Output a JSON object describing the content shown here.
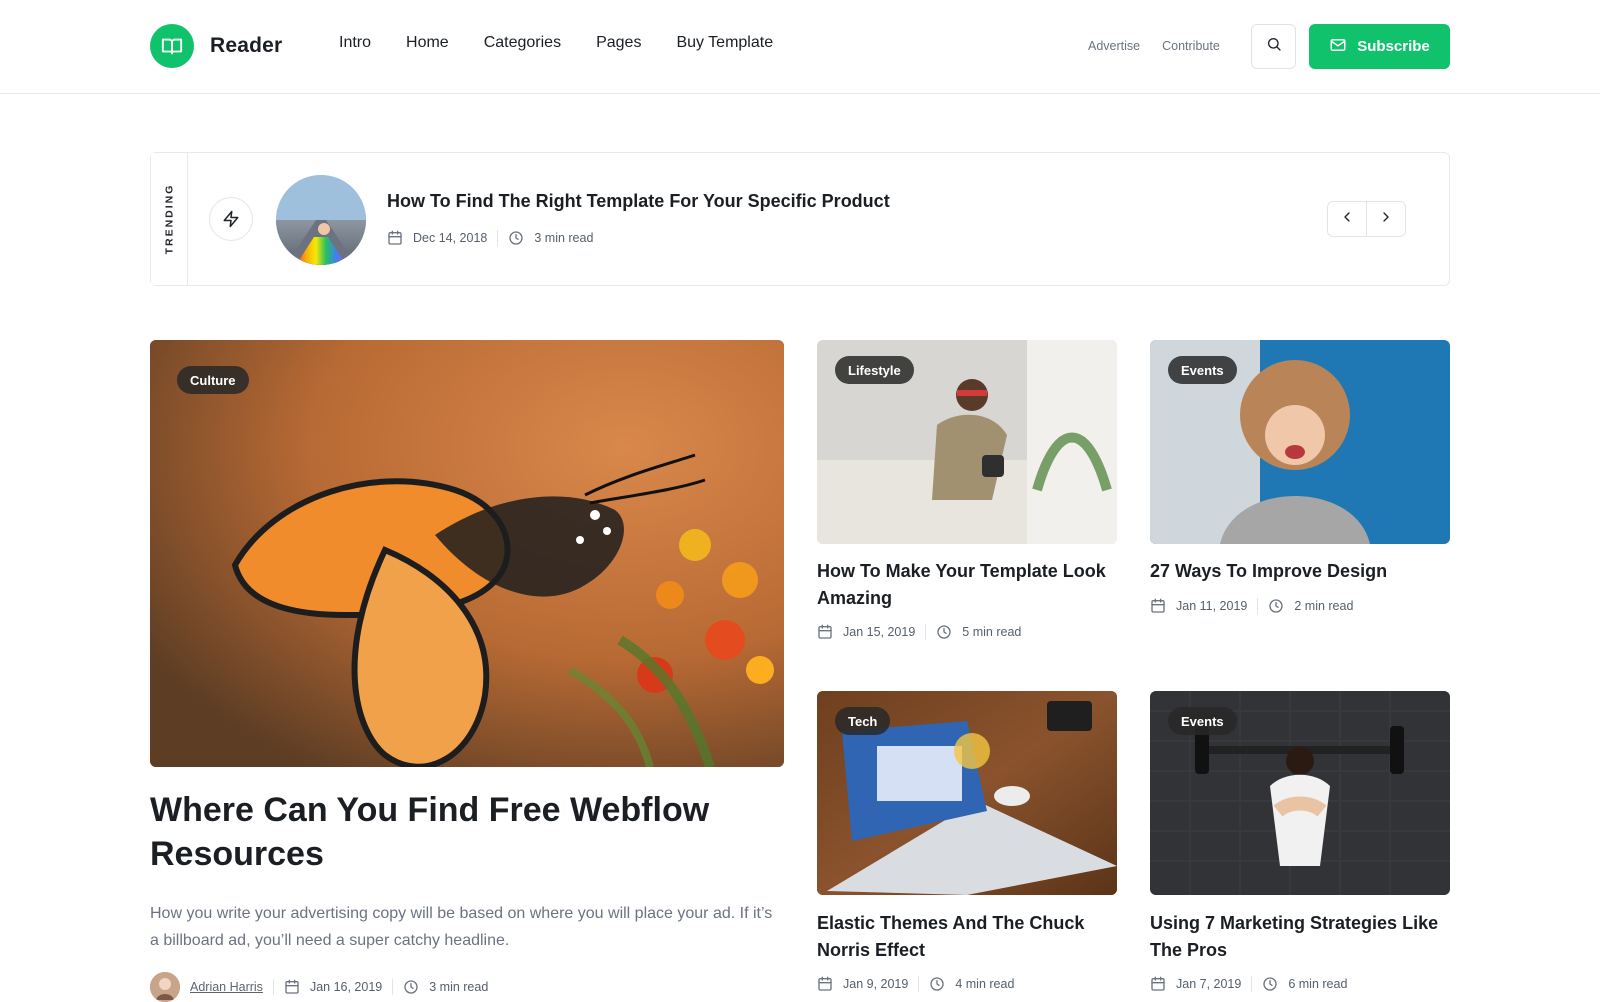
{
  "header": {
    "brand": "Reader",
    "nav": [
      "Intro",
      "Home",
      "Categories",
      "Pages",
      "Buy Template"
    ],
    "links": [
      "Advertise",
      "Contribute"
    ],
    "subscribe_label": "Subscribe",
    "colors": {
      "accent": "#11c26d"
    }
  },
  "trending": {
    "label": "TRENDING",
    "title": "How To Find The Right Template For Your Specific Product",
    "date": "Dec 14, 2018",
    "read": "3 min read"
  },
  "feature": {
    "tag": "Culture",
    "title": "Where Can You Find Free Webflow Resources",
    "excerpt": "How you write your advertising copy will be based on where you will place your ad. If it’s a billboard ad, you’ll need a super catchy headline.",
    "author": "Adrian Harris",
    "date": "Jan 16, 2019",
    "read": "3 min read"
  },
  "cards": [
    {
      "tag": "Lifestyle",
      "title": "How To Make Your Template Look Amazing",
      "date": "Jan 15, 2019",
      "read": "5 min read"
    },
    {
      "tag": "Events",
      "title": "27 Ways To Improve Design",
      "date": "Jan 11, 2019",
      "read": "2 min read"
    },
    {
      "tag": "Tech",
      "title": "Elastic Themes And The Chuck Norris Effect",
      "date": "Jan 9, 2019",
      "read": "4 min read"
    },
    {
      "tag": "Events",
      "title": "Using 7 Marketing Strategies Like The Pros",
      "date": "Jan 7, 2019",
      "read": "6 min read"
    }
  ]
}
